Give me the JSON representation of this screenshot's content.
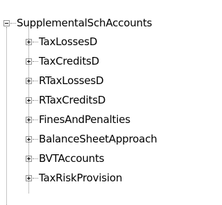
{
  "tree": {
    "root": {
      "label": "SupplementalSchAccounts",
      "expanded": true
    },
    "children": [
      {
        "label": "TaxLossesD",
        "expanded": false
      },
      {
        "label": "TaxCreditsD",
        "expanded": false
      },
      {
        "label": "RTaxLossesD",
        "expanded": false
      },
      {
        "label": "RTaxCreditsD",
        "expanded": false
      },
      {
        "label": "FinesAndPenalties",
        "expanded": false
      },
      {
        "label": "BalanceSheetApproach",
        "expanded": false
      },
      {
        "label": "BVTAccounts",
        "expanded": false
      },
      {
        "label": "TaxRiskProvision",
        "expanded": false
      }
    ]
  }
}
